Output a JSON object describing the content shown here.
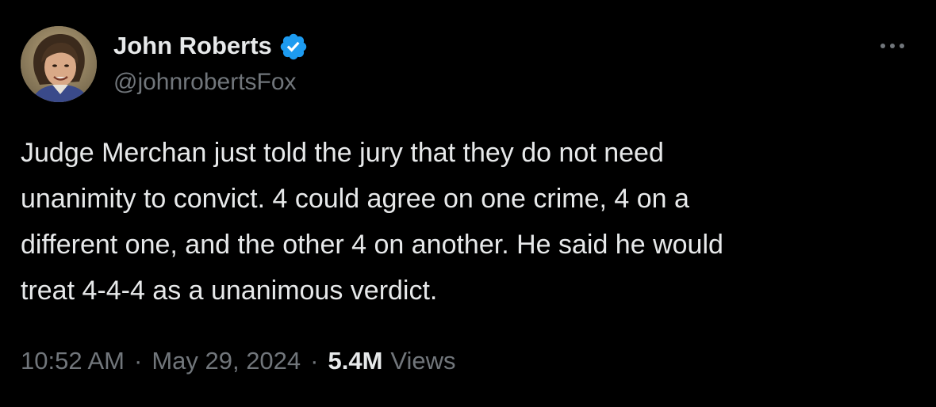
{
  "author": {
    "display_name": "John Roberts",
    "handle": "@johnrobertsFox",
    "verified": true,
    "verified_icon": "verified-badge-icon",
    "avatar_icon": "profile-photo"
  },
  "actions": {
    "more_icon": "more-horizontal-icon",
    "more_label": "···"
  },
  "tweet": {
    "lines": [
      "Judge Merchan just told the jury that they do not need",
      "unanimity to convict. 4 could agree on one crime, 4 on a",
      "different one, and the other 4 on another. He said he would",
      "treat 4-4-4 as a unanimous verdict."
    ]
  },
  "meta": {
    "time": "10:52 AM",
    "date": "May 29, 2024",
    "separator": "·",
    "views_count": "5.4M",
    "views_label": "Views"
  },
  "colors": {
    "background": "#000000",
    "primary_text": "#e7e9ea",
    "secondary_text": "#71767b",
    "verified_blue": "#1d9bf0"
  }
}
